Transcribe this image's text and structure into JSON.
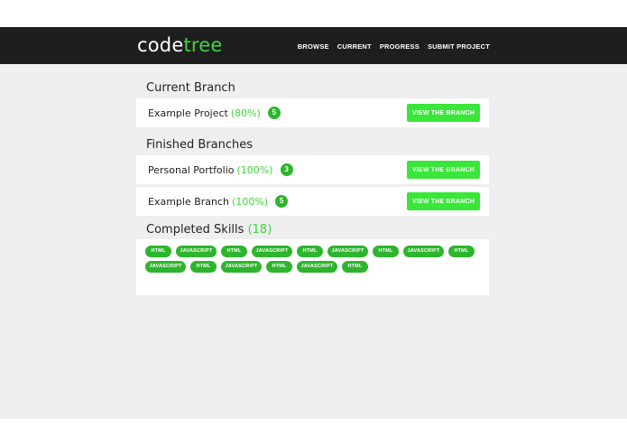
{
  "header": {
    "logo_part1": "code",
    "logo_part2": "tree",
    "nav": [
      "BROWSE",
      "CURRENT",
      "PROGRESS",
      "SUBMIT PROJECT"
    ],
    "brand_color": "#3ed63e",
    "bar_color": "#1e1e1e"
  },
  "current": {
    "heading": "Current Branch",
    "items": [
      {
        "name": "Example Project",
        "pct": "(80%)",
        "badge": "5",
        "button": "VIEW THE BRANCH"
      }
    ]
  },
  "finished": {
    "heading": "Finished Branches",
    "items": [
      {
        "name": "Personal Portfolio",
        "pct": "(100%)",
        "badge": "3",
        "button": "VIEW THE BRANCH"
      },
      {
        "name": "Example Branch",
        "pct": "(100%)",
        "badge": "5",
        "button": "VIEW THE BRANCH"
      }
    ]
  },
  "skills": {
    "heading": "Completed Skills",
    "count": "(18)",
    "tags": [
      "HTML",
      "JAVASCRIPT",
      "HTML",
      "JAVASCRIPT",
      "HTML",
      "JAVASCRIPT",
      "HTML",
      "JAVASCRIPT",
      "HTML",
      "JAVASCRIPT",
      "HTML",
      "JAVASCRIPT",
      "HTML",
      "JAVASCRIPT",
      "HTML"
    ]
  }
}
